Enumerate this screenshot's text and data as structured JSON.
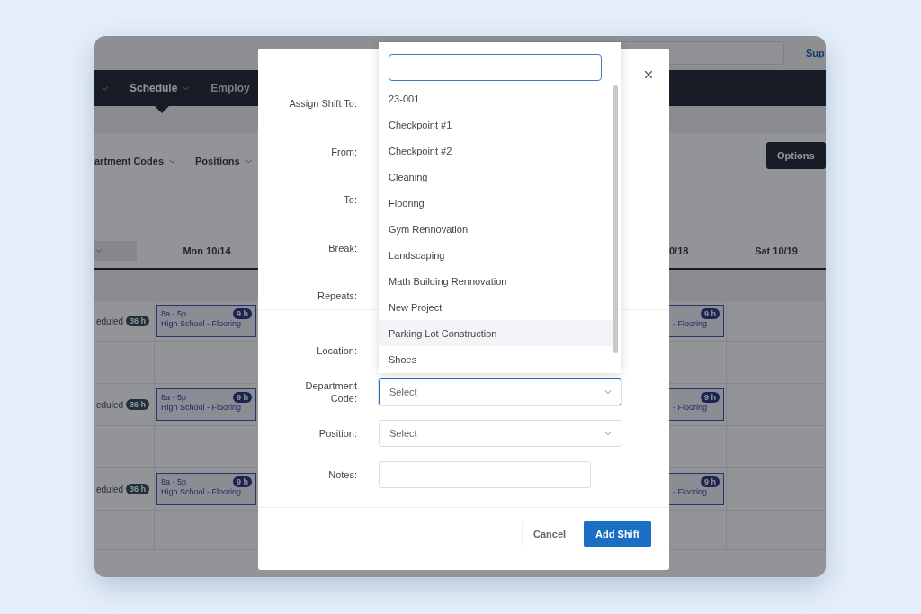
{
  "app": {
    "top_bar": {
      "link": "Sup"
    },
    "nav": [
      {
        "label": "Schedule",
        "selected": true
      },
      {
        "label": "Employ",
        "selected": false
      }
    ],
    "filters": [
      "artment Codes",
      "Positions"
    ],
    "options_button": "Options",
    "days": [
      "Mon 10/14",
      "0/18",
      "Sat 10/19"
    ],
    "rows": [
      {
        "status": "eduled",
        "hours": "36 h",
        "mon_shift": {
          "time": "8a - 5p",
          "hours": "9 h",
          "title": "High School - Flooring"
        },
        "right_shift": {
          "hours": "9 h",
          "title": "- Flooring"
        }
      },
      {
        "status": "eduled",
        "hours": "36 h",
        "mon_shift": {
          "time": "8a - 5p",
          "hours": "9 h",
          "title": "High School - Flooring"
        },
        "right_shift": {
          "hours": "9 h",
          "title": "- Flooring"
        }
      },
      {
        "status": "eduled",
        "hours": "36 h",
        "mon_shift": {
          "time": "8a - 5p",
          "hours": "9 h",
          "title": "High School - Flooring"
        },
        "right_shift": {
          "hours": "9 h",
          "title": "- Flooring"
        }
      }
    ]
  },
  "modal": {
    "sections": [
      {
        "fields": [
          {
            "label": "Assign Shift To:",
            "kind": "covered"
          },
          {
            "label": "From:",
            "kind": "covered"
          },
          {
            "label": "To:",
            "kind": "covered"
          },
          {
            "label": "Break:",
            "kind": "covered"
          },
          {
            "label": "Repeats:",
            "kind": "covered"
          }
        ]
      },
      {
        "fields": [
          {
            "label": "Location:",
            "kind": "covered"
          },
          {
            "label": "Department Code:",
            "kind": "select",
            "placeholder": "Select",
            "focused": true
          },
          {
            "label": "Position:",
            "kind": "select",
            "placeholder": "Select",
            "focused": false
          },
          {
            "label": "Notes:",
            "kind": "text"
          }
        ]
      }
    ],
    "buttons": [
      {
        "label": "Cancel",
        "kind": "secondary"
      },
      {
        "label": "Add Shift",
        "kind": "primary"
      }
    ]
  },
  "dropdown": {
    "items": [
      {
        "label": "23-001",
        "highlighted": false
      },
      {
        "label": "Checkpoint #1",
        "highlighted": false
      },
      {
        "label": "Checkpoint #2",
        "highlighted": false
      },
      {
        "label": "Cleaning",
        "highlighted": false
      },
      {
        "label": "Flooring",
        "highlighted": false
      },
      {
        "label": "Gym Rennovation",
        "highlighted": false
      },
      {
        "label": "Landscaping",
        "highlighted": false
      },
      {
        "label": "Math Building Rennovation",
        "highlighted": false
      },
      {
        "label": "New Project",
        "highlighted": false
      },
      {
        "label": "Parking Lot Construction",
        "highlighted": true
      },
      {
        "label": "Shoes",
        "highlighted": false
      }
    ]
  }
}
